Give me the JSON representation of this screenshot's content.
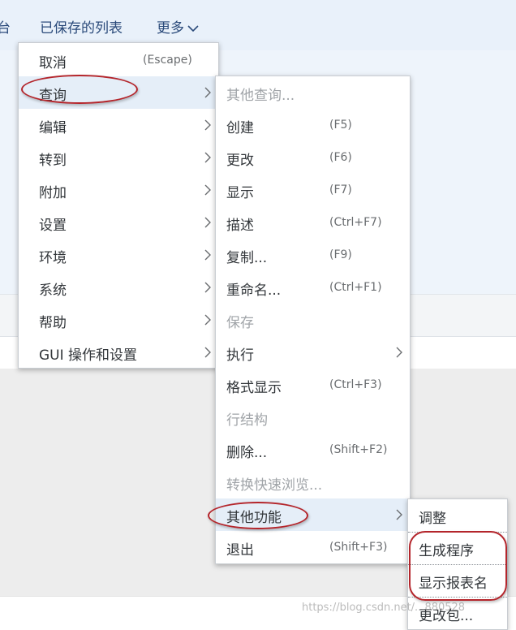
{
  "topbar": {
    "partial_left": "台",
    "saved_lists": "已保存的列表",
    "more": "更多"
  },
  "main_menu": {
    "items": [
      {
        "label": "取消",
        "shortcut": "(Escape)"
      },
      {
        "label": "查询"
      },
      {
        "label": "编辑"
      },
      {
        "label": "转到"
      },
      {
        "label": "附加"
      },
      {
        "label": "设置"
      },
      {
        "label": "环境"
      },
      {
        "label": "系统"
      },
      {
        "label": "帮助"
      },
      {
        "label": "GUI 操作和设置"
      }
    ]
  },
  "query_menu": {
    "items": [
      {
        "label": "其他查询...",
        "disabled": true
      },
      {
        "label": "创建",
        "shortcut": "(F5)"
      },
      {
        "label": "更改",
        "shortcut": "(F6)"
      },
      {
        "label": "显示",
        "shortcut": "(F7)"
      },
      {
        "label": "描述",
        "shortcut": "(Ctrl+F7)"
      },
      {
        "label": "复制...",
        "shortcut": "(F9)"
      },
      {
        "label": "重命名...",
        "shortcut": "(Ctrl+F1)"
      },
      {
        "label": "保存",
        "disabled": true
      },
      {
        "label": "执行"
      },
      {
        "label": "格式显示",
        "shortcut": "(Ctrl+F3)"
      },
      {
        "label": "行结构",
        "disabled": true
      },
      {
        "label": "删除...",
        "shortcut": "(Shift+F2)"
      },
      {
        "label": "转换快速浏览...",
        "disabled": true
      },
      {
        "label": "其他功能"
      },
      {
        "label": "退出",
        "shortcut": "(Shift+F3)"
      }
    ]
  },
  "other_functions_menu": {
    "items": [
      {
        "label": "调整"
      },
      {
        "label": "生成程序"
      },
      {
        "label": "显示报表名"
      },
      {
        "label": "更改包..."
      }
    ]
  },
  "watermark": "https://blog.csdn.net/...880528",
  "colors": {
    "highlight": "#e5eef8",
    "annotation_red": "#b4252b",
    "topbar_bg": "#e9f1fa"
  }
}
